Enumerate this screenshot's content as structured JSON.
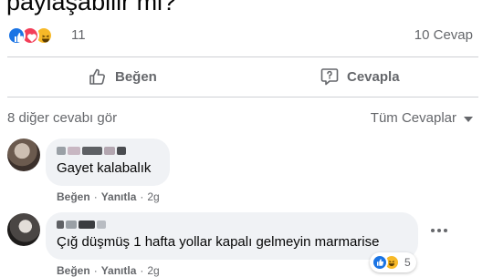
{
  "post": {
    "title_fragment": "paylaşabilir mi?"
  },
  "stats": {
    "reaction_icons": [
      "like-icon",
      "love-icon",
      "haha-icon"
    ],
    "reaction_count": "11",
    "reply_count": "10 Cevap"
  },
  "actions": {
    "like_label": "Beğen",
    "reply_label": "Cevapla"
  },
  "replies_bar": {
    "more_label": "8 diğer cevabı gör",
    "sort_label": "Tüm Cevaplar"
  },
  "comments": [
    {
      "name_blurred": true,
      "text": "Gayet kalabalık",
      "like_action": "Beğen",
      "reply_action": "Yanıtla",
      "time": "2g"
    },
    {
      "name_blurred": true,
      "text": "Çığ düşmüş 1 hafta yollar kapalı gelmeyin marmarise",
      "like_action": "Beğen",
      "reply_action": "Yanıtla",
      "time": "2g",
      "reaction_icons": [
        "like-icon",
        "haha-icon"
      ],
      "reaction_count": "5"
    }
  ],
  "colors": {
    "like_blue": "#1b74e4",
    "love_red": "#f33e58",
    "haha_yellow": "#f7b928",
    "secondary_text": "#65676b",
    "bubble_bg": "#f0f2f5",
    "divider": "#ced0d4"
  }
}
